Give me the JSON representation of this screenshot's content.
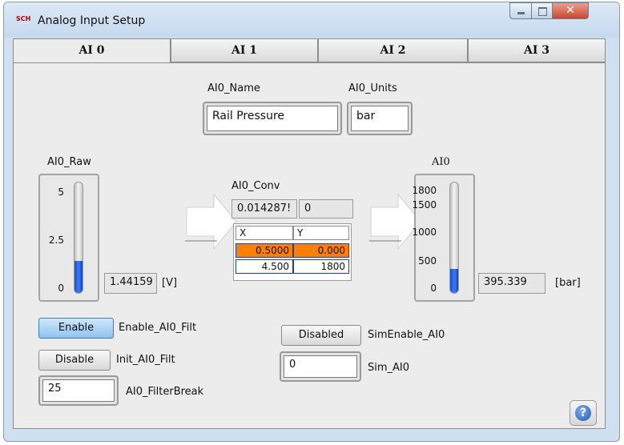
{
  "window": {
    "title": "Analog Input Setup",
    "app_icon_text": "SCH",
    "close_glyph": "✕"
  },
  "tabs": [
    {
      "label": "AI 0",
      "active": true
    },
    {
      "label": "AI 1",
      "active": false
    },
    {
      "label": "AI 2",
      "active": false
    },
    {
      "label": "AI 3",
      "active": false
    }
  ],
  "name_field": {
    "label": "AI0_Name",
    "value": "Rail Pressure"
  },
  "units_field": {
    "label": "AI0_Units",
    "value": "bar"
  },
  "raw_gauge": {
    "label": "AI0_Raw",
    "ticks": [
      "5",
      "2.5",
      "0"
    ],
    "value_display": "1.44159",
    "unit": "[V]",
    "level_fraction": 0.288
  },
  "conversion": {
    "label": "AI0_Conv",
    "slope": "0.014287!",
    "offset": "0",
    "headers": [
      "X",
      "Y"
    ],
    "rows": [
      {
        "x": "0.5000",
        "y": "0.000",
        "highlight": true
      },
      {
        "x": "4.500",
        "y": "1800",
        "highlight": false
      }
    ],
    "highlight_color": "#ff8000"
  },
  "output_gauge": {
    "label": "AI0",
    "ticks": [
      "1800",
      "1500",
      "1000",
      "500",
      "0"
    ],
    "value_display": "395.339",
    "unit": "[bar]",
    "level_fraction": 0.22
  },
  "filter": {
    "enable_button": "Enable",
    "enable_label": "Enable_AI0_Filt",
    "init_button": "Disable",
    "init_label": "Init_AI0_Filt",
    "break_value": "25",
    "break_label": "AI0_FilterBreak"
  },
  "simulation": {
    "button": "Disabled",
    "button_label": "SimEnable_AI0",
    "value": "0",
    "value_label": "Sim_AI0"
  },
  "help": {
    "glyph": "?"
  },
  "colors": {
    "accent_fill": "#2a63e6",
    "active_button": "#a9d3f5"
  }
}
